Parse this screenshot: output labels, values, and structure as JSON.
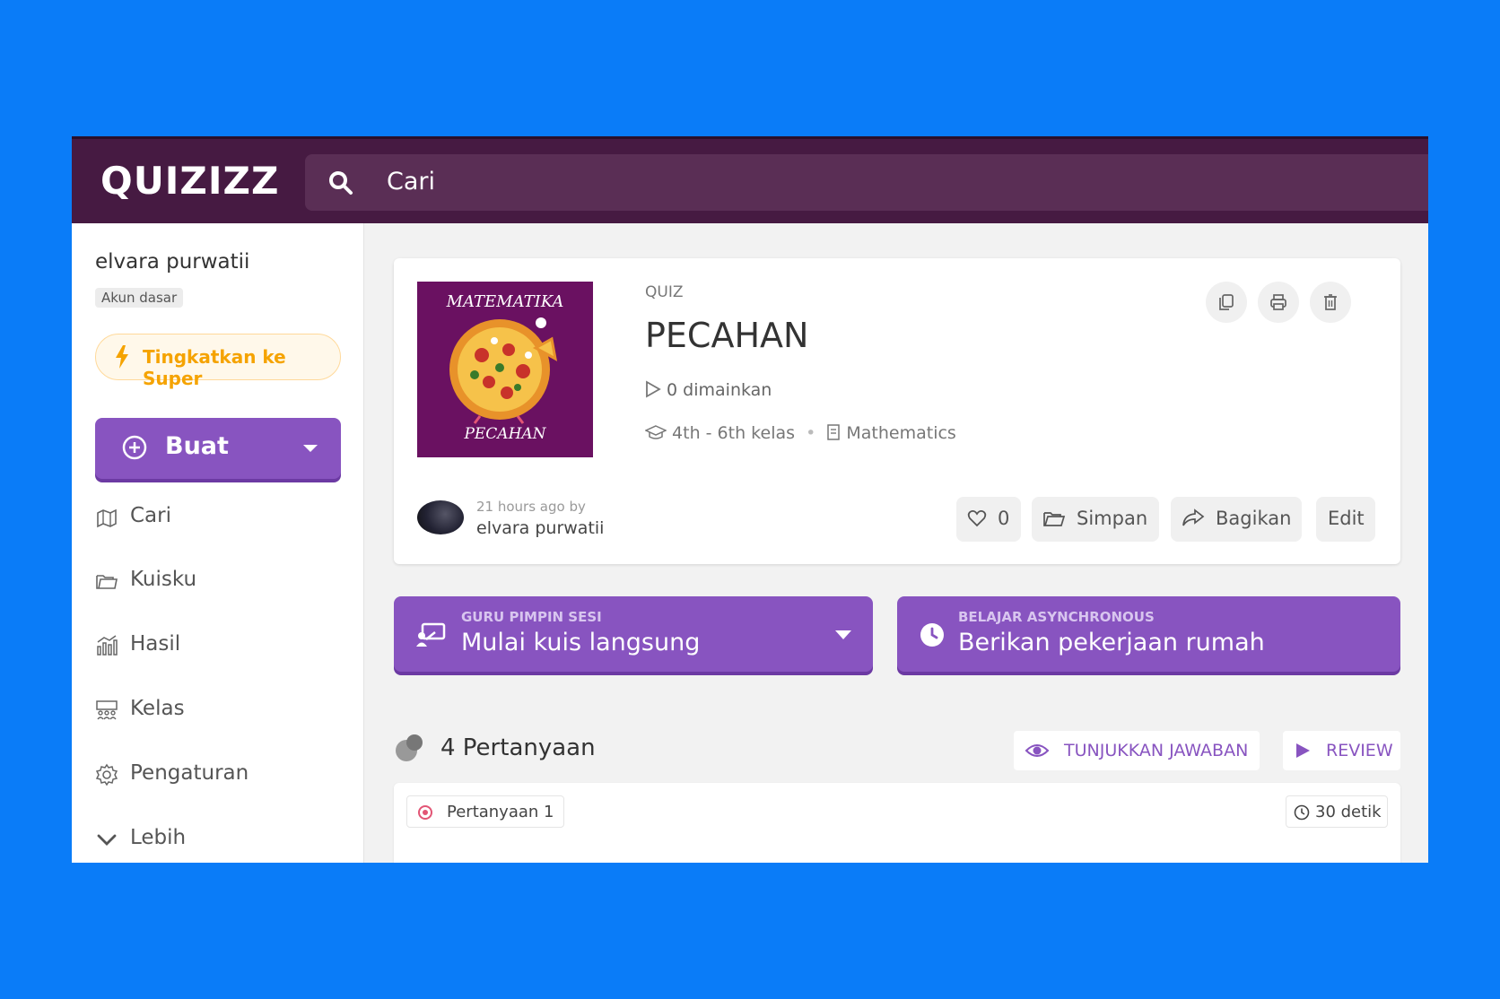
{
  "app": {
    "brand": "QUIZIZZ"
  },
  "search": {
    "placeholder": "Cari"
  },
  "sidebar": {
    "user_name": "elvara purwatii",
    "account_type": "Akun dasar",
    "upgrade_label": "Tingkatkan ke Super",
    "create_label": "Buat",
    "items": [
      {
        "label": "Cari",
        "icon": "search-map-icon"
      },
      {
        "label": "Kuisku",
        "icon": "folder-icon"
      },
      {
        "label": "Hasil",
        "icon": "chart-icon"
      },
      {
        "label": "Kelas",
        "icon": "classroom-icon"
      },
      {
        "label": "Pengaturan",
        "icon": "gear-icon"
      },
      {
        "label": "Lebih",
        "icon": "chevron-down-icon"
      }
    ]
  },
  "quiz": {
    "type": "QUIZ",
    "title": "PECAHAN",
    "thumbnail_top": "MATEMATIKA",
    "thumbnail_bottom": "PECAHAN",
    "played": "0 dimainkan",
    "grade": "4th - 6th kelas",
    "subject": "Mathematics",
    "created_ago": "21 hours ago by",
    "author": "elvara purwatii",
    "likes": "0",
    "save_label": "Simpan",
    "share_label": "Bagikan",
    "edit_label": "Edit"
  },
  "actions": {
    "live": {
      "small": "GURU PIMPIN SESI",
      "big": "Mulai kuis langsung"
    },
    "async": {
      "small": "BELAJAR ASYNCHRONOUS",
      "big": "Berikan pekerjaan rumah"
    }
  },
  "questions": {
    "count_label": "4 Pertanyaan",
    "show_answers_label": "TUNJUKKAN JAWABAN",
    "review_label": "REVIEW",
    "first": {
      "label": "Pertanyaan 1",
      "time": "30 detik"
    }
  },
  "colors": {
    "brand": "#461a42",
    "accent": "#8854c0",
    "background": "#0a7cf8",
    "upgrade": "#f5a300"
  }
}
